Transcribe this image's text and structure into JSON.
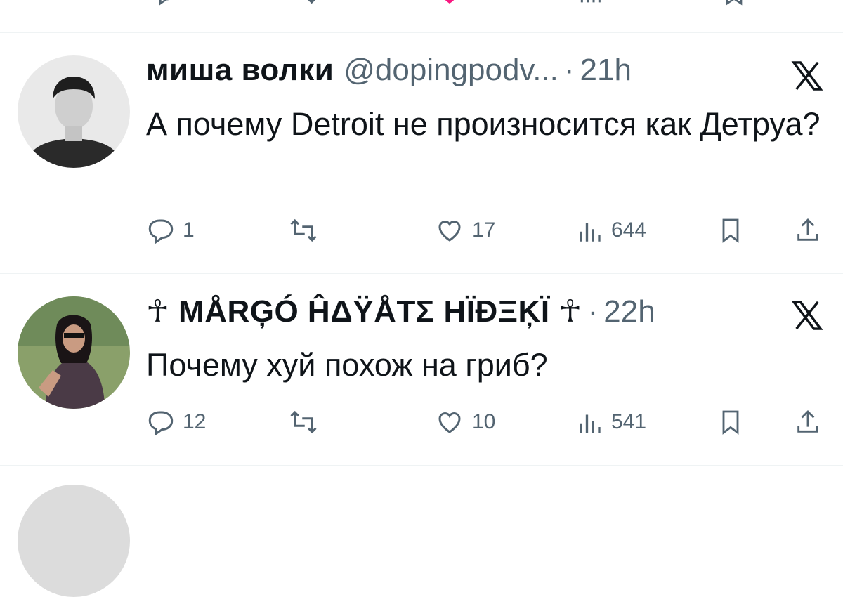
{
  "tweets": [
    {
      "display_name": "миша волки",
      "handle": "@dopingpodv...",
      "separator": "·",
      "time": "21h",
      "text": "А почему Detroit не произносится как Детруа?",
      "replies": "1",
      "likes": "17",
      "views": "644"
    },
    {
      "display_name": "☥ MÅRĢÓ ĤΔŸÅTΣ HÏÐΞĶÏ ☥",
      "handle": "",
      "separator": "·",
      "time": "22h",
      "text": "Почему хуй похож на гриб?",
      "replies": "12",
      "likes": "10",
      "views": "541"
    }
  ],
  "colors": {
    "text": "#0f1419",
    "secondary": "#536471",
    "divider": "#eff3f4",
    "like_pink": "#f91880"
  },
  "icons": [
    "reply-icon",
    "retweet-icon",
    "like-icon",
    "views-icon",
    "bookmark-icon",
    "share-icon",
    "grok-x-icon"
  ]
}
